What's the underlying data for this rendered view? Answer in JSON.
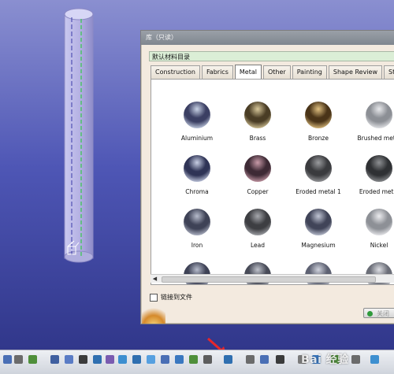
{
  "dialog": {
    "title": "库（只读）",
    "catalog_path": "默认材料目录",
    "tabs": [
      {
        "label": "Construction",
        "active": false
      },
      {
        "label": "Fabrics",
        "active": false
      },
      {
        "label": "Metal",
        "active": true
      },
      {
        "label": "Other",
        "active": false
      },
      {
        "label": "Painting",
        "active": false
      },
      {
        "label": "Shape Review",
        "active": false
      },
      {
        "label": "Stone",
        "active": false
      }
    ],
    "materials": [
      {
        "name": "Aluminium",
        "color": "#3b3f63",
        "highlight": "#c9d3e6"
      },
      {
        "name": "Brass",
        "color": "#4a3d25",
        "highlight": "#d8c89a"
      },
      {
        "name": "Bronze",
        "color": "#4a3418",
        "highlight": "#e0c080"
      },
      {
        "name": "Brushed metal",
        "color": "#8c8f95",
        "highlight": "#e8e9ec"
      },
      {
        "name": "Chroma",
        "color": "#2f3456",
        "highlight": "#c8cfe4"
      },
      {
        "name": "Copper",
        "color": "#3e2a35",
        "highlight": "#c89aa8"
      },
      {
        "name": "Eroded metal 1",
        "color": "#3a3b3e",
        "highlight": "#9a9b9e"
      },
      {
        "name": "Eroded metal",
        "color": "#2f3134",
        "highlight": "#8e9093"
      },
      {
        "name": "Iron",
        "color": "#3e4256",
        "highlight": "#b7bccc"
      },
      {
        "name": "Lead",
        "color": "#3d3e42",
        "highlight": "#a6a8ad"
      },
      {
        "name": "Magnesium",
        "color": "#404458",
        "highlight": "#c0c5d4"
      },
      {
        "name": "Nickel",
        "color": "#8d9096",
        "highlight": "#ececef"
      },
      {
        "name": "",
        "color": "#3e4256",
        "highlight": "#b7bccc"
      },
      {
        "name": "",
        "color": "#474a57",
        "highlight": "#c0c3cc"
      },
      {
        "name": "",
        "color": "#5d6172",
        "highlight": "#d1d4de"
      },
      {
        "name": "",
        "color": "#6b6e78",
        "highlight": "#dfe0e5"
      }
    ],
    "link_label": "链接到文件",
    "close_label": "关闭"
  },
  "watermark": "Bai 经验",
  "colors": {
    "viewport_top": "#8a8fd0",
    "viewport_bottom": "#2d3385",
    "annotation_red": "#e8262b",
    "catalog_path_bg": "#dbeed6"
  }
}
